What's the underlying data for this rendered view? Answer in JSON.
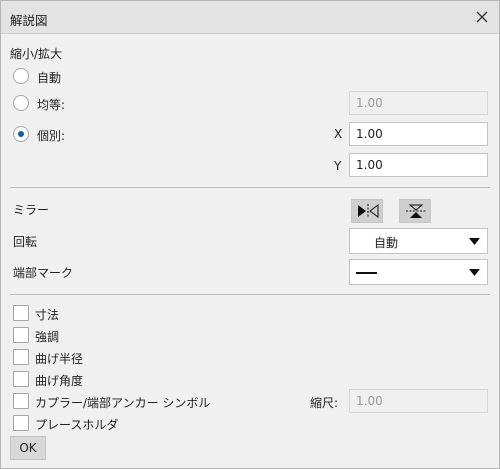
{
  "window": {
    "title": "解説図"
  },
  "scale": {
    "heading": "縮小/拡大",
    "auto_label": "自動",
    "uniform_label": "均等:",
    "uniform_value": "1.00",
    "individual_label": "個別:",
    "x_label": "X",
    "x_value": "1.00",
    "y_label": "Y",
    "y_value": "1.00",
    "selected": "individual"
  },
  "mirror": {
    "label": "ミラー",
    "icons": [
      "mirror-horizontal-icon",
      "mirror-vertical-icon"
    ]
  },
  "rotation": {
    "label": "回転",
    "value": "自動"
  },
  "end_mark": {
    "label": "端部マーク",
    "value": "solid-line"
  },
  "options": {
    "items": [
      {
        "label": "寸法",
        "checked": false
      },
      {
        "label": "強調",
        "checked": false
      },
      {
        "label": "曲げ半径",
        "checked": false
      },
      {
        "label": "曲げ角度",
        "checked": false
      },
      {
        "label": "カプラー/端部アンカー シンボル",
        "checked": false
      },
      {
        "label": "プレースホルダ",
        "checked": false
      }
    ],
    "symbol_scale_label": "縮尺:",
    "symbol_scale_value": "1.00"
  },
  "footer": {
    "ok_label": "OK"
  },
  "colors": {
    "accent": "#0b5fb5",
    "background": "#f0f0f0",
    "titlebar": "#e3e3e3"
  }
}
